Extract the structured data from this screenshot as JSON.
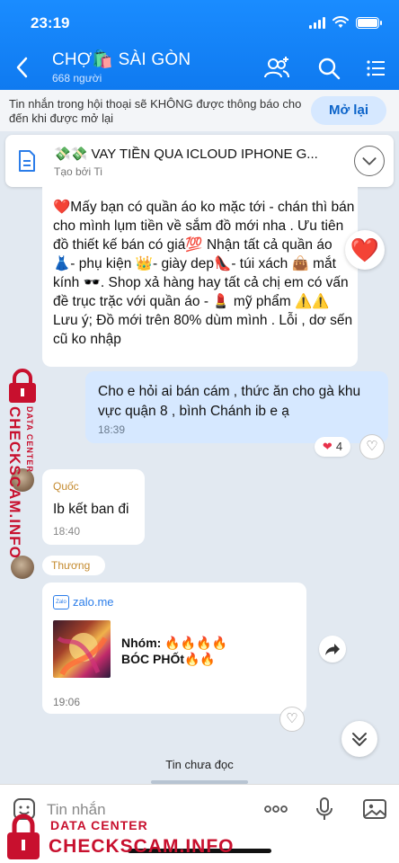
{
  "status_bar": {
    "time": "23:19"
  },
  "header": {
    "title": "CHỢ🛍️ SÀI GÒN",
    "subtitle": "668 người"
  },
  "notice": {
    "text": "Tin nhắn trong hội thoại sẽ KHÔNG được thông báo cho đến khi được mở lại",
    "button": "Mở lại"
  },
  "pinned": {
    "title": "💸💸 VAY TIỀN QUA ICLOUD IPHONE G...",
    "creator": "Tạo bởi Ti"
  },
  "messages": {
    "m1": {
      "text": "❤️Mấy bạn có quần áo ko mặc tới - chán thì bán cho mình lụm tiền về sắm đồ mới nha . Ưu tiên đồ thiết kế bán có giá💯 Nhận tất cả quần áo 👗- phụ kiện 👑- giày dep👠- túi xách 👜 mắt kính 🕶️. Shop xả hàng hay tất cả chị em có vấn đề trục trặc với quần áo - 💄 mỹ phẩm ⚠️⚠️ Lưu ý; Đồ mới trên 80% dùm mình . Lỗi , dơ sến cũ ko nhập",
      "reaction_icon": "❤️"
    },
    "m2": {
      "text": "Cho e hỏi ai bán cám , thức ăn cho gà khu vực quận 8 , bình Chánh ib e ạ",
      "time": "18:39",
      "reaction_count": "4"
    },
    "m3": {
      "sender": "Quốc",
      "text": "Ib kết ban đi",
      "time": "18:40"
    },
    "m4": {
      "sender": "Thương",
      "link_host": "zalo.me",
      "link_logo": "Zalo",
      "link_title_line1": "Nhóm: 🔥🔥🔥🔥",
      "link_title_line2": "BÓC PHỐt🔥🔥",
      "time": "19:06"
    }
  },
  "unread_label": "Tin chưa đọc",
  "input": {
    "placeholder": "Tin nhắn"
  },
  "watermark": {
    "label_small": "DATA CENTER",
    "label_big": "CHECKSCAM.INFO"
  },
  "colors": {
    "header": "#0f7af0",
    "sent_bubble": "#d6e8ff",
    "watermark": "#c8102e",
    "heart": "#e8314a"
  }
}
